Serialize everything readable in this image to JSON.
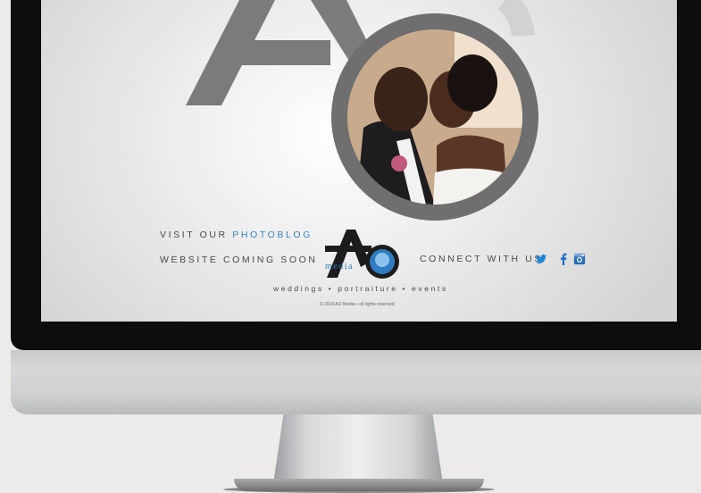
{
  "nav": {
    "visit_prefix": "VISIT OUR ",
    "visit_link": "PHOTOBLOG",
    "coming_soon": "WEBSITE COMING SOON",
    "connect": "CONNECT WITH US"
  },
  "logo": {
    "letter": "A",
    "media": "media"
  },
  "tagline": "weddings  •  portraiture  •  events",
  "copyright": "© 2014 AO Media • all rights reserved",
  "social_icons": [
    "twitter-icon",
    "facebook-icon",
    "instagram-icon"
  ],
  "colors": {
    "accent": "#3c82c4",
    "mono_gray": "#7a7a7a",
    "text": "#4a4a4a"
  }
}
